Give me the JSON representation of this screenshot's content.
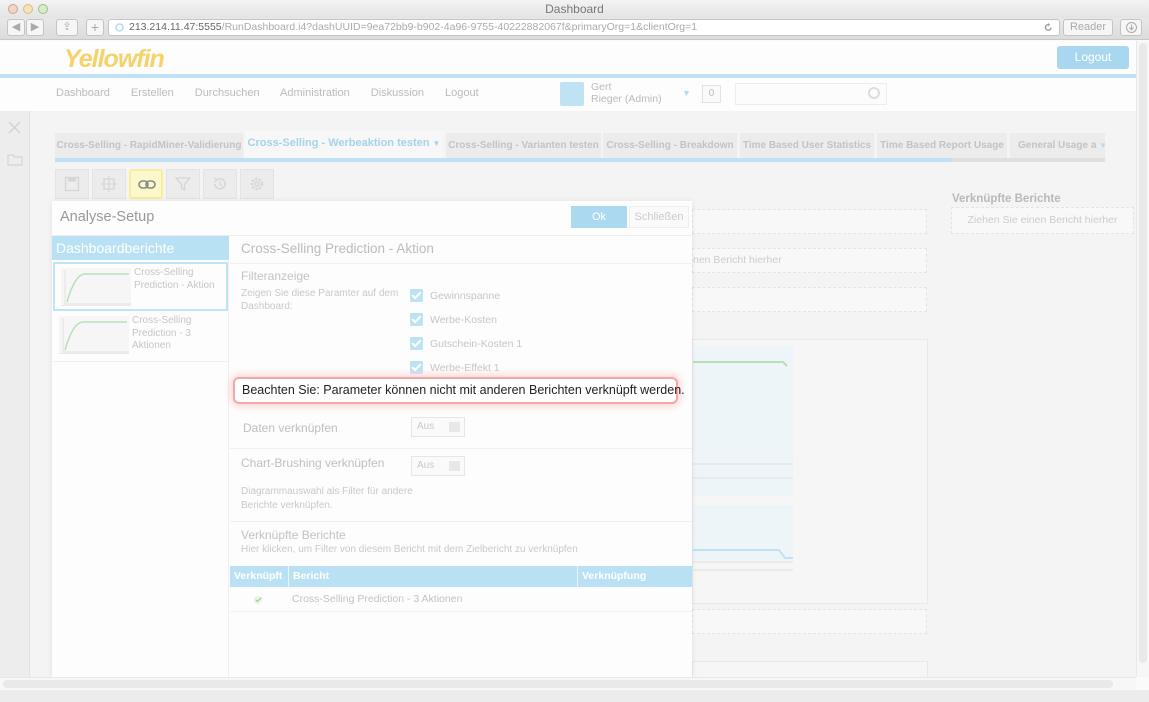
{
  "window": {
    "title": "Dashboard"
  },
  "browser": {
    "url_host": "213.214.11.47:5555",
    "url_path": "/RunDashboard.i4?dashUUID=9ea72bb9-b902-4a96-9755-40222882067f&primaryOrg=1&clientOrg=1",
    "reader_label": "Reader",
    "back_symbol": "◀",
    "forward_symbol": "▶",
    "share_symbol": "⇪",
    "add_symbol": "+"
  },
  "header": {
    "logo": "Yellowfin",
    "logout": "Logout",
    "nav": [
      "Dashboard",
      "Erstellen",
      "Durchsuchen",
      "Administration",
      "Diskussion",
      "Logout"
    ],
    "user_first": "Gert",
    "user_last": "Rieger (Admin)",
    "notif_count": "0"
  },
  "tabs": [
    "Cross-Selling - RapidMiner-Validierung",
    "Cross-Selling - Werbeaktion testen",
    "Cross-Selling - Varianten testen",
    "Cross-Selling - Breakdown",
    "Time Based User Statistics",
    "Time Based Report Usage",
    "General Usage a"
  ],
  "background": {
    "linked_reports_title": "Verknüpfte Berichte",
    "drag_hint": "Ziehen Sie einen Bericht hierher",
    "drag_hint_partial": "nen Bericht hierher"
  },
  "dialog": {
    "title": "Analyse-Setup",
    "ok": "Ok",
    "close": "Schließen",
    "left_header": "Dashboardberichte",
    "reports": [
      {
        "label": "Cross-Selling Prediction - Aktion"
      },
      {
        "label": "Cross-Selling Prediction - 3 Aktionen"
      }
    ],
    "report_title": "Cross-Selling Prediction - Aktion",
    "filter_title": "Filteranzeige",
    "filter_desc": "Zeigen Sie diese Paramter auf dem Dashboard:",
    "params": [
      "Gewinnspanne",
      "Werbe-Kosten",
      "Gutschein-Kosten 1",
      "Werbe-Effekt 1"
    ],
    "warning": "Beachten Sie: Parameter können nicht mit anderen Berichten verknüpft werden.",
    "data_link_label": "Daten verknüpfen",
    "data_link_value": "Aus",
    "brush_label": "Chart-Brushing verknüpfen",
    "brush_value": "Aus",
    "brush_desc": "Diagrammauswahl als Filter für andere Berichte verknüpfen.",
    "linked_title": "Verknüpfte Berichte",
    "linked_desc": "Hier klicken, um Filter von diesem Bericht mit dem Zielbericht zu verknüpfen",
    "table_headers": [
      "Verknüpft",
      "Bericht",
      "Verknüpfung"
    ],
    "table_rows": [
      {
        "report": "Cross-Selling Prediction - 3 Aktionen",
        "linked": true
      }
    ]
  }
}
